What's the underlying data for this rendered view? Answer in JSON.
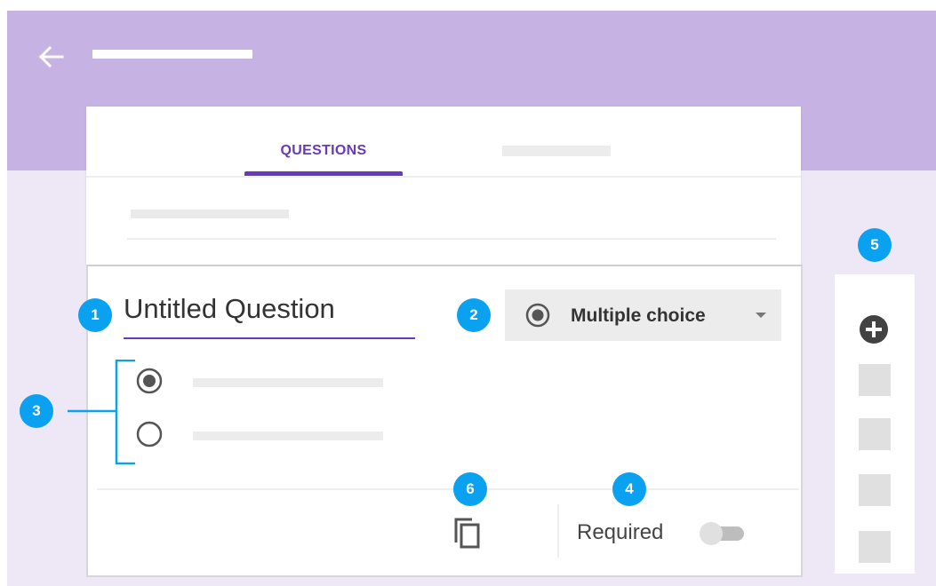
{
  "header": {
    "back_icon": "arrow-left-icon"
  },
  "tabs": {
    "questions_label": "QUESTIONS"
  },
  "question": {
    "title": "Untitled Question",
    "type_label": "Multiple choice",
    "type_icon": "radio-checked-icon",
    "required_label": "Required",
    "required_on": false
  },
  "toolbar": {
    "add_icon": "add-circle-icon",
    "copy_icon": "copy-icon"
  },
  "callouts": [
    "1",
    "2",
    "3",
    "4",
    "5",
    "6"
  ],
  "colors": {
    "header": "#c6b3e3",
    "background": "#ede7f6",
    "accent": "#673ab7",
    "callout": "#0aa1f0"
  }
}
